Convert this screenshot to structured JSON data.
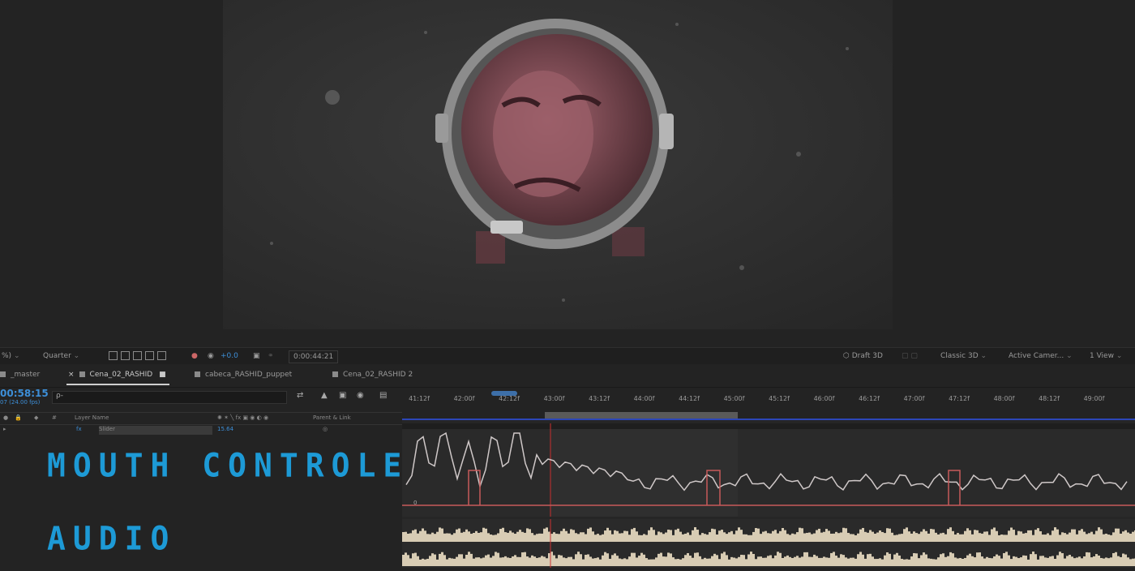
{
  "viewer_toolbar": {
    "zoom": "%)",
    "resolution": "Quarter",
    "exposure": "+0.0",
    "time": "0:00:44:21",
    "renderer": "Draft 3D",
    "renderer_mode": "Classic 3D",
    "camera": "Active Camer...",
    "views": "1 View"
  },
  "tabs": [
    {
      "label": "_master",
      "color": "#8a8a8a",
      "active": false
    },
    {
      "label": "Cena_02_RASHID",
      "color": "#8a8a8a",
      "active": true
    },
    {
      "label": "cabeca_RASHID_puppet",
      "color": "#8a8a8a",
      "active": false
    },
    {
      "label": "Cena_02_RASHID 2",
      "color": "#8a8a8a",
      "active": false
    }
  ],
  "timeline": {
    "timecode": "00:58:15",
    "fps": "07 (24.00 fps)",
    "search_icon": "ρ-",
    "columns": {
      "layer_name": "Layer Name",
      "parent": "Parent & Link"
    },
    "layer": {
      "name": "Slider",
      "value": "15.64",
      "fx": "fx"
    },
    "ruler_ticks": [
      "41:12f",
      "42:00f",
      "42:12f",
      "43:00f",
      "43:12f",
      "44:00f",
      "44:12f",
      "45:00f",
      "45:12f",
      "46:00f",
      "46:12f",
      "47:00f",
      "47:12f",
      "48:00f",
      "48:12f",
      "49:00f"
    ],
    "graph_zero_label": "0"
  },
  "overlay": {
    "mouth_label": "MOUTH CONTROLER",
    "audio_label": "AUDIO"
  },
  "colors": {
    "accent_blue": "#3d8fd8",
    "label_blue": "#1d9ad6",
    "graph_line": "#cfc8c8",
    "graph_red": "#c75a5a",
    "audio_wave": "#d8ccb4",
    "work_area_green": "#4ec24e"
  }
}
